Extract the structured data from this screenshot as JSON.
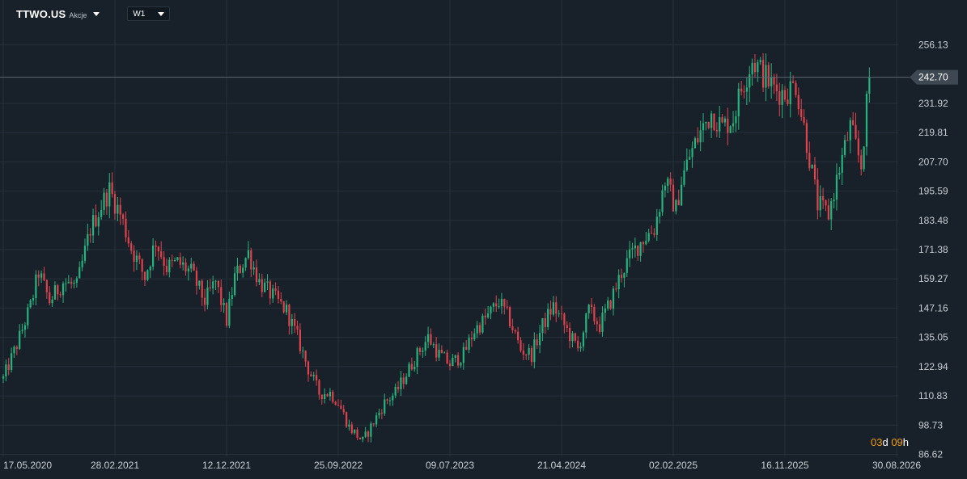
{
  "header": {
    "symbol": "TTWO.US",
    "asset_type": "Akcje",
    "interval": "W1"
  },
  "countdown": {
    "days": "03",
    "day_unit": "d",
    "hours": "09",
    "hour_unit": "h"
  },
  "colors": {
    "background": "#18212a",
    "grid": "#26313b",
    "up": "#26b47e",
    "down": "#e0424c",
    "axis_text": "#c8cdd3",
    "price_line": "#5b6670",
    "price_tag": "#3d4852",
    "countdown_accent": "#f39c12"
  },
  "chart_data": {
    "type": "candlestick",
    "interval": "W1",
    "y_ticks": [
      "256.13",
      "231.92",
      "219.81",
      "207.70",
      "195.59",
      "183.48",
      "171.38",
      "159.27",
      "147.16",
      "135.05",
      "122.94",
      "110.83",
      "98.73",
      "86.62"
    ],
    "ylim": [
      86.62,
      256.13
    ],
    "x_ticks": [
      "17.05.2020",
      "28.02.2021",
      "12.12.2021",
      "25.09.2022",
      "09.07.2023",
      "21.04.2024",
      "02.02.2025",
      "16.11.2025",
      "30.08.2026"
    ],
    "current_price": 242.7,
    "current_price_label": "242.70",
    "approx_path": [
      [
        "2020-05-17",
        118
      ],
      [
        "2020-06-21",
        132
      ],
      [
        "2020-07-26",
        148
      ],
      [
        "2020-08-16",
        162
      ],
      [
        "2020-09-13",
        150
      ],
      [
        "2020-10-18",
        158
      ],
      [
        "2020-11-22",
        156
      ],
      [
        "2020-12-27",
        180
      ],
      [
        "2021-01-31",
        192
      ],
      [
        "2021-02-14",
        196
      ],
      [
        "2021-03-14",
        186
      ],
      [
        "2021-04-11",
        172
      ],
      [
        "2021-05-16",
        160
      ],
      [
        "2021-06-13",
        175
      ],
      [
        "2021-07-11",
        164
      ],
      [
        "2021-08-08",
        166
      ],
      [
        "2021-09-12",
        162
      ],
      [
        "2021-10-17",
        150
      ],
      [
        "2021-11-14",
        158
      ],
      [
        "2021-12-12",
        142
      ],
      [
        "2022-01-02",
        160
      ],
      [
        "2022-02-06",
        170
      ],
      [
        "2022-03-06",
        158
      ],
      [
        "2022-04-10",
        152
      ],
      [
        "2022-05-15",
        146
      ],
      [
        "2022-06-12",
        135
      ],
      [
        "2022-07-10",
        122
      ],
      [
        "2022-08-07",
        112
      ],
      [
        "2022-09-04",
        112
      ],
      [
        "2022-09-25",
        108
      ],
      [
        "2022-10-23",
        98
      ],
      [
        "2022-11-27",
        92
      ],
      [
        "2022-12-25",
        100
      ],
      [
        "2023-01-22",
        108
      ],
      [
        "2023-02-19",
        112
      ],
      [
        "2023-03-19",
        120
      ],
      [
        "2023-04-16",
        128
      ],
      [
        "2023-05-14",
        135
      ],
      [
        "2023-06-11",
        128
      ],
      [
        "2023-07-09",
        124
      ],
      [
        "2023-08-13",
        128
      ],
      [
        "2023-09-10",
        138
      ],
      [
        "2023-10-15",
        144
      ],
      [
        "2023-11-12",
        150
      ],
      [
        "2023-12-10",
        142
      ],
      [
        "2024-01-07",
        130
      ],
      [
        "2024-02-04",
        128
      ],
      [
        "2024-03-03",
        140
      ],
      [
        "2024-03-31",
        148
      ],
      [
        "2024-04-28",
        140
      ],
      [
        "2024-06-02",
        130
      ],
      [
        "2024-06-30",
        146
      ],
      [
        "2024-07-28",
        140
      ],
      [
        "2024-08-25",
        150
      ],
      [
        "2024-09-22",
        162
      ],
      [
        "2024-10-20",
        170
      ],
      [
        "2024-11-17",
        176
      ],
      [
        "2024-12-15",
        180
      ],
      [
        "2025-01-12",
        200
      ],
      [
        "2025-02-09",
        188
      ],
      [
        "2025-02-23",
        200
      ],
      [
        "2025-03-16",
        210
      ],
      [
        "2025-04-13",
        220
      ],
      [
        "2025-05-11",
        228
      ],
      [
        "2025-06-08",
        222
      ],
      [
        "2025-07-06",
        226
      ],
      [
        "2025-07-27",
        238
      ],
      [
        "2025-08-24",
        250
      ],
      [
        "2025-09-21",
        244
      ],
      [
        "2025-10-19",
        238
      ],
      [
        "2025-11-16",
        236
      ],
      [
        "2025-12-14",
        240
      ],
      [
        "2026-01-11",
        216
      ],
      [
        "2026-02-08",
        190
      ],
      [
        "2026-03-08",
        186
      ],
      [
        "2026-04-05",
        205
      ],
      [
        "2026-05-03",
        222
      ],
      [
        "2026-05-31",
        206
      ],
      [
        "2026-06-21",
        242.7
      ]
    ]
  }
}
